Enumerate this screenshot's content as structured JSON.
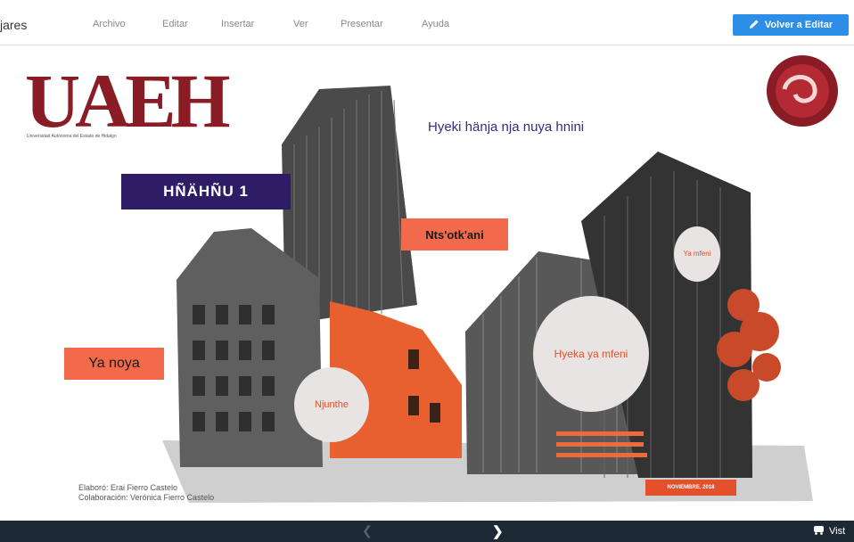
{
  "app": {
    "title": "jares"
  },
  "menu": {
    "items": [
      "Archivo",
      "Editar",
      "Insertar",
      "Ver",
      "Presentar",
      "Ayuda"
    ]
  },
  "toolbar": {
    "edit_button": "Volver a Editar"
  },
  "slide": {
    "logo_text": "UAEH",
    "logo_caption": "Universidad Autónoma del Estado de Hidalgo",
    "header_text": "Hyeki hänja nja nuya hnini",
    "title_box": "HÑÄHÑU 1",
    "nts_box": "Nts'otk'ani",
    "noya_box": "Ya noya",
    "circle_njunthe": "Njunthe",
    "circle_hyeka": "Hyeka ya mfeni",
    "circle_ya_mfeni": "Ya mfeni",
    "credit_elaboro": "Elaboró: Erai Fierro Castelo",
    "credit_colaboracion": "Colaboración: Verónica Fierro Castelo",
    "date_tag": "NOVIEMBRE, 2018"
  },
  "bottom": {
    "view_label": "Vist"
  },
  "colors": {
    "accent": "#2d8ee8",
    "coral": "#f26a4b",
    "purple": "#2e1d66",
    "maroon": "#8a1c26",
    "dark_bar": "#1e2936"
  }
}
